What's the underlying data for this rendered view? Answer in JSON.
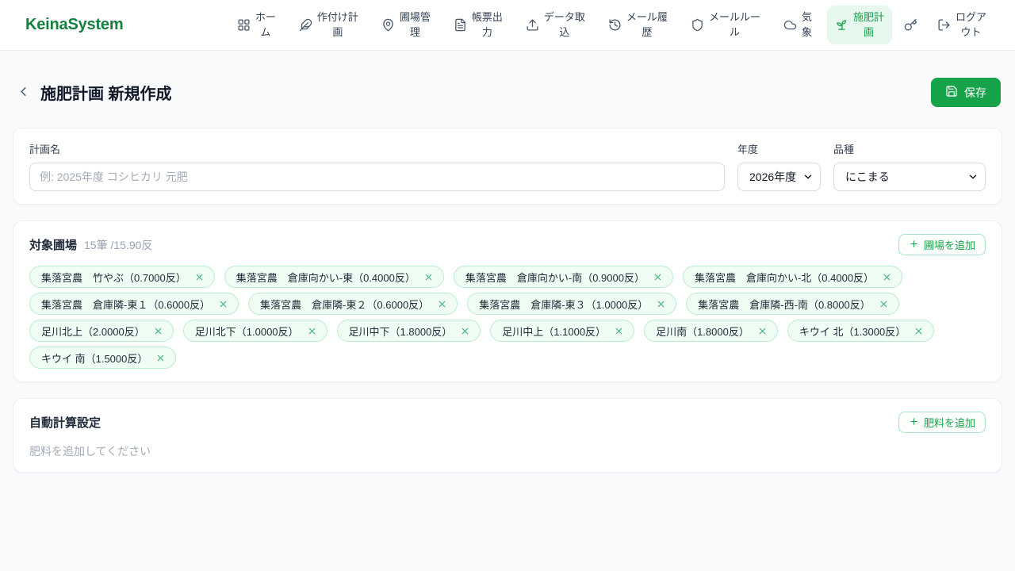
{
  "brand": "KeinaSystem",
  "nav": {
    "items": [
      {
        "id": "home",
        "icon": "grid-icon",
        "label": "ホーム",
        "lines": [
          "ホー",
          "ム"
        ],
        "active": false
      },
      {
        "id": "cropping-plan",
        "icon": "feather-icon",
        "label": "作付け計画",
        "lines": [
          "作付け計",
          "画"
        ],
        "active": false
      },
      {
        "id": "field-management",
        "icon": "map-pin-icon",
        "label": "圃場管理",
        "lines": [
          "圃場管",
          "理"
        ],
        "active": false
      },
      {
        "id": "report-output",
        "icon": "document-icon",
        "label": "帳票出力",
        "lines": [
          "帳票出",
          "力"
        ],
        "active": false
      },
      {
        "id": "data-import",
        "icon": "upload-icon",
        "label": "データ取込",
        "lines": [
          "データ取",
          "込"
        ],
        "active": false
      },
      {
        "id": "mail-history",
        "icon": "history-icon",
        "label": "メール履歴",
        "lines": [
          "メール履",
          "歴"
        ],
        "active": false
      },
      {
        "id": "mail-rules",
        "icon": "shield-icon",
        "label": "メールルール",
        "lines": [
          "メールルー",
          "ル"
        ],
        "active": false
      },
      {
        "id": "weather",
        "icon": "cloud-icon",
        "label": "気象",
        "lines": [
          "気",
          "象"
        ],
        "active": false
      },
      {
        "id": "fertilization-plan",
        "icon": "sprout-icon",
        "label": "施肥計画",
        "lines": [
          "施肥計",
          "画"
        ],
        "active": true
      },
      {
        "id": "key",
        "icon": "key-icon",
        "label": "",
        "lines": [],
        "active": false
      },
      {
        "id": "logout",
        "icon": "logout-icon",
        "label": "ログアウト",
        "lines": [
          "ログア",
          "ウト"
        ],
        "active": false
      }
    ]
  },
  "page": {
    "title": "施肥計画 新規作成",
    "save_button_label": "保存"
  },
  "plan_form": {
    "name": {
      "label": "計画名",
      "value": "",
      "placeholder": "例: 2025年度 コシヒカリ 元肥"
    },
    "year": {
      "label": "年度",
      "value": "2026年度"
    },
    "variety": {
      "label": "品種",
      "value": "にこまる"
    }
  },
  "target_fields": {
    "title": "対象圃場",
    "summary": "15筆 /15.90反",
    "add_button_label": "圃場を追加",
    "chips": [
      "集落宮農　竹やぶ（0.7000反）",
      "集落宮農　倉庫向かい-東（0.4000反）",
      "集落宮農　倉庫向かい-南（0.9000反）",
      "集落宮農　倉庫向かい-北（0.4000反）",
      "集落宮農　倉庫隣-東１（0.6000反）",
      "集落宮農　倉庫隣-東２（0.6000反）",
      "集落宮農　倉庫隣-東３（1.0000反）",
      "集落宮農　倉庫隣-西-南（0.8000反）",
      "足川北上（2.0000反）",
      "足川北下（1.0000反）",
      "足川中下（1.8000反）",
      "足川中上（1.1000反）",
      "足川南（1.8000反）",
      "キウイ 北（1.3000反）",
      "キウイ 南（1.5000反）"
    ]
  },
  "auto_calc": {
    "title": "自動計算設定",
    "add_button_label": "肥料を追加",
    "empty_message": "肥料を追加してください"
  },
  "colors": {
    "primary_green": "#16a34a",
    "brand_green": "#15803d",
    "active_nav_bg": "#e7f8ee",
    "chip_bg": "#f0fdf4",
    "chip_border": "#b9edcd",
    "page_bg": "#f8fafc"
  }
}
